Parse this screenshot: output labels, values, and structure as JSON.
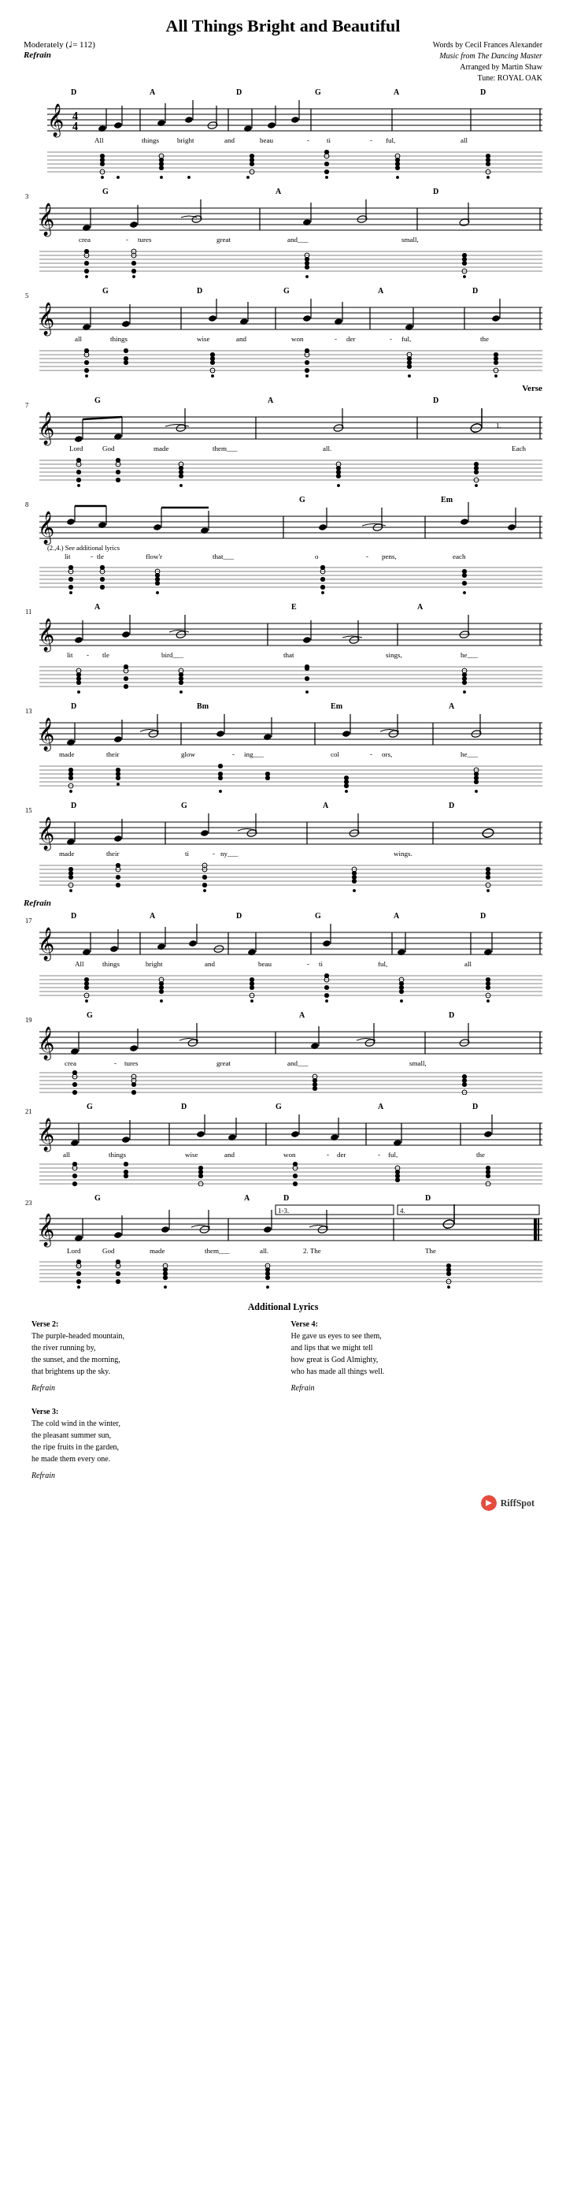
{
  "title": "All Things Bright and Beautiful",
  "credits": {
    "words": "Words by Cecil Frances Alexander",
    "music": "Music from The Dancing Master",
    "arranged": "Arranged by Martin Shaw",
    "tune": "Tune: ROYAL OAK"
  },
  "tempo": {
    "label": "Moderately",
    "bpm": "♩= 112"
  },
  "sections": {
    "refrain": "Refrain",
    "verse": "Verse",
    "additional_lyrics": "Additional Lyrics"
  },
  "additional_lyrics": {
    "verse2_title": "Verse 2:",
    "verse2_text": "The purple-headed mountain,\nthe river running by,\nthe sunset, and the morning,\nthat brightens up the sky.",
    "verse2_refrain": "Refrain",
    "verse3_title": "Verse 3:",
    "verse3_text": "The cold wind in the winter,\nthe pleasant summer sun,\nthe ripe fruits in the garden,\nhe made them every one.",
    "verse3_refrain": "Refrain",
    "verse4_title": "Verse 4:",
    "verse4_text": "He gave us eyes to see them,\nand lips that we might tell\nhow great is God Almighty,\nwho has made all things well.",
    "verse4_refrain": "Refrain"
  },
  "riffspot": "RiffSpot"
}
